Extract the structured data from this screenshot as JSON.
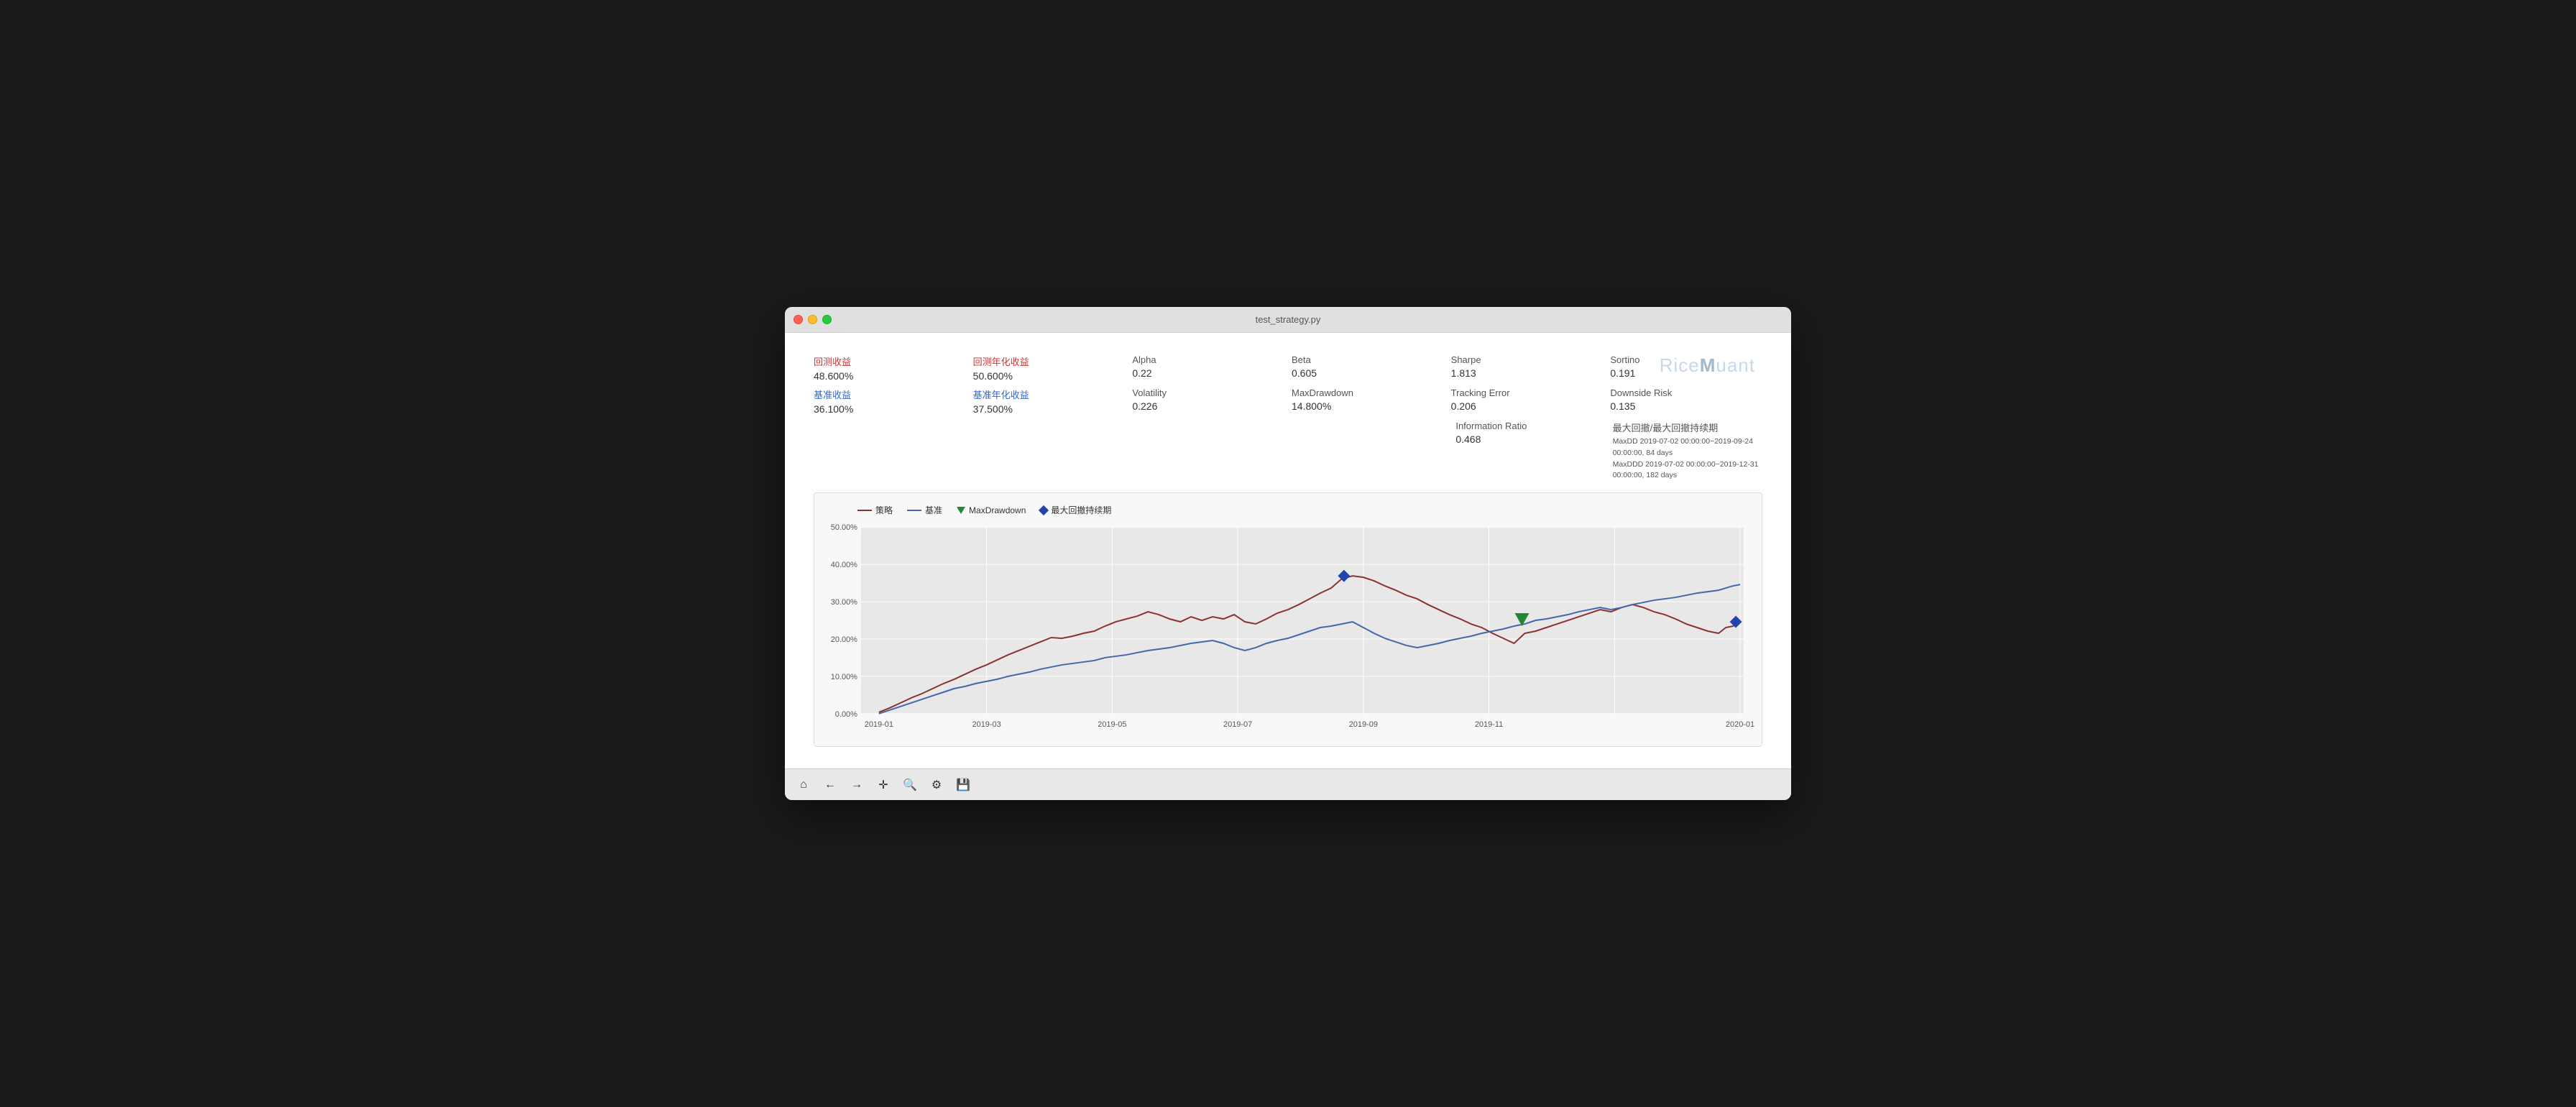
{
  "window": {
    "title": "test_strategy.py"
  },
  "stats": {
    "row1": [
      {
        "label": "回测收益",
        "value": "48.600%",
        "label_class": "red"
      },
      {
        "label": "回测年化收益",
        "value": "50.600%",
        "label_class": "red"
      },
      {
        "label": "Alpha",
        "value": "0.22",
        "label_class": "gray"
      },
      {
        "label": "Beta",
        "value": "0.605",
        "label_class": "gray"
      },
      {
        "label": "Sharpe",
        "value": "1.813",
        "label_class": "gray"
      },
      {
        "label": "Sortino",
        "value": "0.191",
        "label_class": "gray"
      }
    ],
    "row2": [
      {
        "label": "基准收益",
        "value": "36.100%",
        "label_class": "blue"
      },
      {
        "label": "基准年化收益",
        "value": "37.500%",
        "label_class": "blue"
      },
      {
        "label": "Volatility",
        "value": "0.226",
        "label_class": "gray"
      },
      {
        "label": "MaxDrawdown",
        "value": "14.800%",
        "label_class": "gray"
      },
      {
        "label": "Tracking Error",
        "value": "0.206",
        "label_class": "gray"
      },
      {
        "label": "Downside Risk",
        "value": "0.135",
        "label_class": "gray"
      }
    ],
    "info_ratio_label": "Information Ratio",
    "info_ratio_value": "0.468",
    "maxdd_label": "最大回撤/最大回撤持续期",
    "maxdd_line1": "MaxDD  2019-07-02 00:00:00~2019-09-24 00:00:00, 84 days",
    "maxdd_line2": "MaxDDD 2019-07-02 00:00:00~2019-12-31 00:00:00, 182 days"
  },
  "legend": {
    "strategy": "策略",
    "benchmark": "基准",
    "maxdrawdown": "MaxDrawdown",
    "maxddd": "最大回撤持续期"
  },
  "chart": {
    "x_labels": [
      "2019-01",
      "2019-03",
      "2019-05",
      "2019-07",
      "2019-09",
      "2019-11",
      "2020-01"
    ],
    "y_labels": [
      "50.00%",
      "40.00%",
      "30.00%",
      "20.00%",
      "10.00%",
      "0.00%"
    ]
  },
  "toolbar": {
    "home": "⌂",
    "back": "←",
    "forward": "→",
    "move": "✛",
    "search": "🔍",
    "settings": "⚙",
    "save": "💾"
  },
  "watermark": "Rice",
  "watermark2": "uant"
}
